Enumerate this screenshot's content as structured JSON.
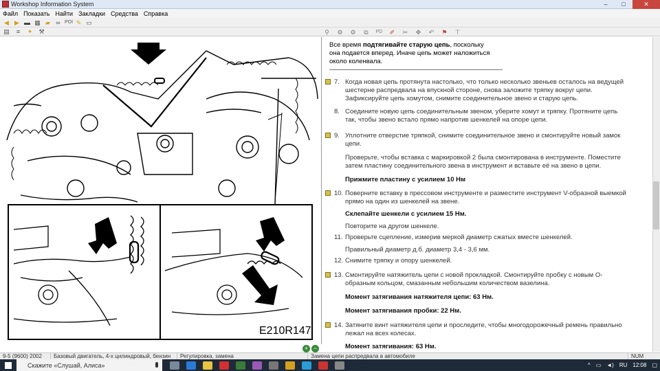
{
  "window": {
    "title": "Workshop Information System"
  },
  "menu": {
    "items": [
      "Файл",
      "Показать",
      "Найти",
      "Закладки",
      "Средства",
      "Справка"
    ]
  },
  "figure": {
    "label": "E210R147"
  },
  "note": {
    "line1_pre": "Все время ",
    "line1_bold": "подтягивайте старую цепь",
    "line1_post": ", поскольку",
    "line2": "она подается вперед. Иначе цепь может наложиться",
    "line3": "около коленвала."
  },
  "steps": [
    {
      "num": "7.",
      "lines": [
        "Когда новая цепь протянута настолько, что только несколько звеньев осталось на ведущей",
        "шестерне распредвала на впускной стороне, снова заложите тряпку вокруг цепи.",
        "Зафиксируйте цепь хомутом, снимите соединительное звено и старую цепь."
      ]
    },
    {
      "num": "8.",
      "lines": [
        "Соедините новую цепь соединительным звеном, уберите хомут и тряпку. Протяните цепь",
        "так, чтобы звено встало прямо напротив шенкелей на опоре цепи."
      ]
    },
    {
      "num": "9.",
      "lines": [
        "Уплотните отверстие тряпкой, снимите соединительное звено и смонтируйте новый замок",
        "цепи."
      ],
      "extra": [
        "Проверьте, чтобы вставка с маркировкой 2 была смонтирована в инструменте. Поместите",
        "затем пластину соединительного звена в инструмент и вставьте её на звено в цепи."
      ],
      "bold": "Прижмите пластину с усилием 10 Нм"
    },
    {
      "num": "10.",
      "lines": [
        "Поверните вставку в прессовом инструменте и разместите инструмент V-образной выемкой",
        "прямо на один из шенкелей на звене."
      ],
      "bold": "Склепайте шенкели с усилием 15 Нм.",
      "after": "Повторите на другом шенкеле."
    },
    {
      "num": "11.",
      "lines": [
        "Проверьте сцепление, измерив меркой диаметр сжатых вместе шенкелей."
      ],
      "after": "Правильный диаметр д.б. диаметр 3,4 - 3,6 мм."
    },
    {
      "num": "12.",
      "lines": [
        "Снимите тряпку и опору шенкелей."
      ]
    },
    {
      "num": "13.",
      "lines": [
        "Смонтируйте натяжитель цепи с новой прокладкой. Смонтируйте пробку с новым О-",
        "образным кольцом, смазанным небольшим количеством вазелина."
      ],
      "bold": "Момент затягивания натяжителя цепи: 63 Нм.",
      "bold2": "Момент затягивания пробки: 22 Нм."
    },
    {
      "num": "14.",
      "lines": [
        "Затяните винт натяжителя цепи и проследите, чтобы многодорожечный ремень правильно",
        "лежал на всех колесах."
      ],
      "bold": "Момент затягивания: 63 Нм."
    }
  ],
  "status": {
    "model": "9-5 (9600) 2002",
    "engine": "Базовый двигатель, 4-х цилиндровый, бензин",
    "section": "Регулировка, замена",
    "doc": "Замена цепи распредвала в автомобиле",
    "num": "NUM"
  },
  "taskbar": {
    "search_placeholder": "Скажите «Слушай, Алиса»",
    "lang": "RU",
    "time": "12:08"
  }
}
